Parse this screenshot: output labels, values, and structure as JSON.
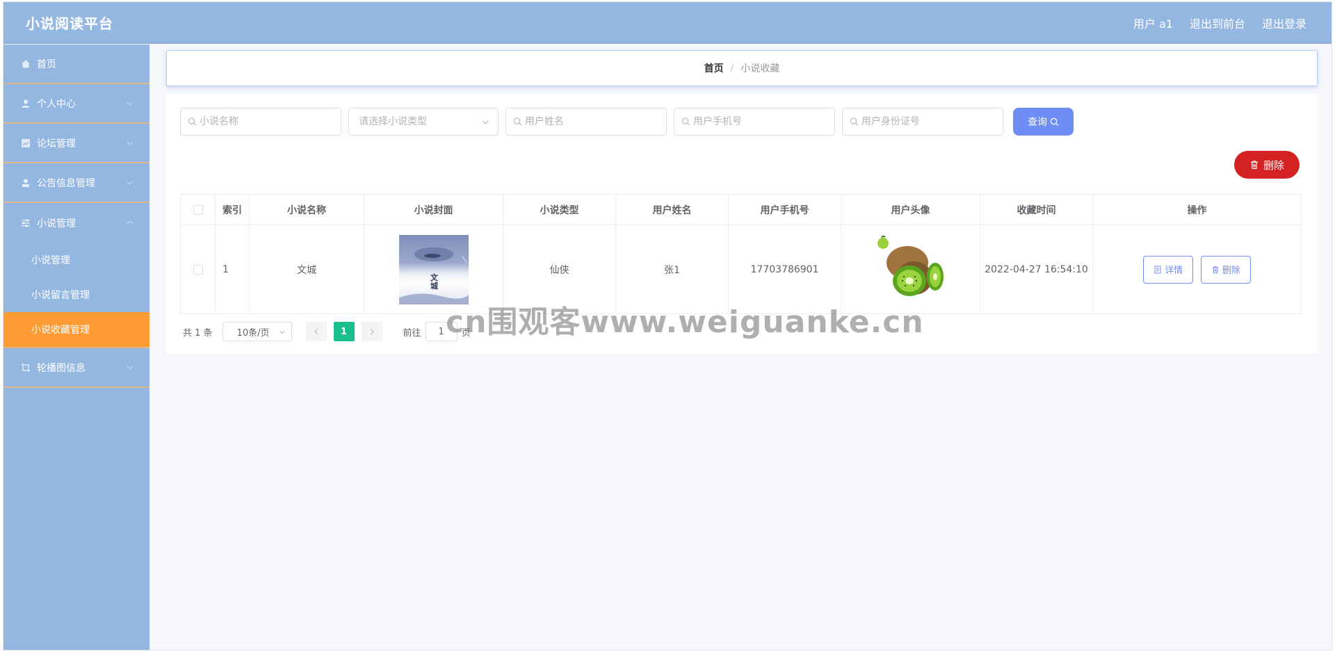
{
  "header": {
    "title": "小说阅读平台",
    "links": {
      "user": "用户 a1",
      "front": "退出到前台",
      "logout": "退出登录"
    }
  },
  "sidebar": {
    "items": [
      {
        "label": "首页",
        "icon": "home-icon"
      },
      {
        "label": "个人中心",
        "icon": "user-icon"
      },
      {
        "label": "论坛管理",
        "icon": "chart-icon"
      },
      {
        "label": "公告信息管理",
        "icon": "person-icon"
      },
      {
        "label": "小说管理",
        "icon": "sliders-icon"
      },
      {
        "label": "轮播图信息",
        "icon": "crop-icon"
      }
    ],
    "submenu": [
      "小说管理",
      "小说留言管理",
      "小说收藏管理"
    ]
  },
  "breadcrumb": {
    "home": "首页",
    "sep": "/",
    "current": "小说收藏"
  },
  "search": {
    "name_placeholder": "小说名称",
    "type_placeholder": "请选择小说类型",
    "username_placeholder": "用户姓名",
    "phone_placeholder": "用户手机号",
    "idcard_placeholder": "用户身份证号",
    "query_label": "查询"
  },
  "actions": {
    "delete_label": "删除"
  },
  "table": {
    "headers": [
      "索引",
      "小说名称",
      "小说封面",
      "小说类型",
      "用户姓名",
      "用户手机号",
      "用户头像",
      "收藏时间",
      "操作"
    ],
    "rows": [
      {
        "index": "1",
        "name": "文城",
        "type": "仙侠",
        "username": "张1",
        "phone": "17703786901",
        "time": "2022-04-27 16:54:10",
        "cover_title": "文城",
        "detail_label": "详情",
        "delete_label": "删除"
      }
    ]
  },
  "pagination": {
    "total": "共 1 条",
    "page_size": "10条/页",
    "current_page": "1",
    "goto_label": "前往",
    "goto_value": "1",
    "page_unit": "页"
  },
  "watermark": "cn围观客www.weiguanke.cn",
  "colors": {
    "header_bg": "#94b7e2",
    "active_menu": "#ff9b33",
    "primary": "#6e8ef5",
    "danger": "#d42122",
    "page_active": "#1bbf8b"
  }
}
